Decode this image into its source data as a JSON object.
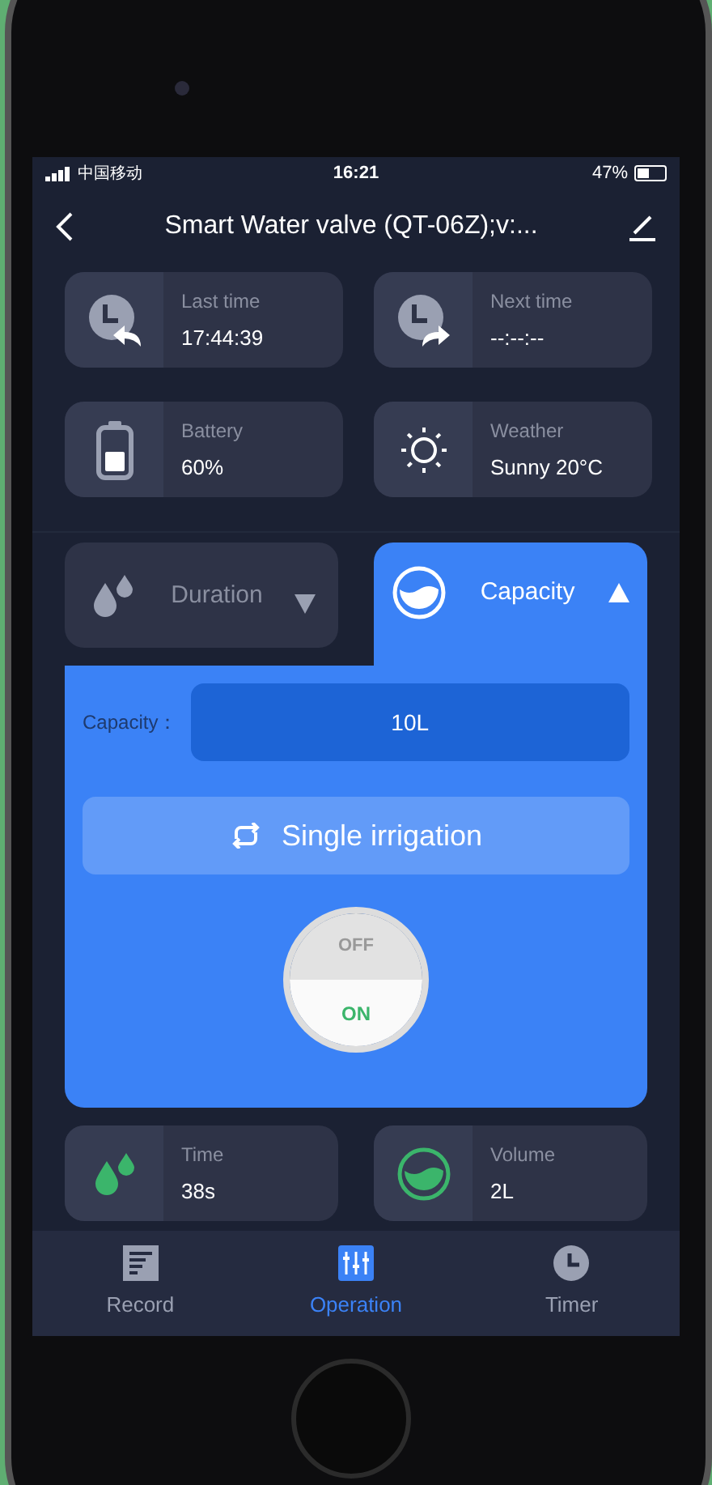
{
  "status_bar": {
    "carrier": "中国移动",
    "time": "16:21",
    "battery": "47%"
  },
  "header": {
    "title": "Smart Water valve (QT-06Z);v:..."
  },
  "info_cards": [
    {
      "kind": "last",
      "label": "Last time",
      "value": "17:44:39"
    },
    {
      "kind": "next",
      "label": "Next time",
      "value": "--:--:--"
    },
    {
      "kind": "battery",
      "label": "Battery",
      "value": "60%"
    },
    {
      "kind": "weather",
      "label": "Weather",
      "value": "Sunny 20°C"
    }
  ],
  "mode_tabs": [
    {
      "kind": "drops",
      "label": "Duration",
      "selected": false
    },
    {
      "kind": "water",
      "label": "Capacity",
      "selected": true
    }
  ],
  "capacity_field": {
    "label": "Capacity：",
    "value": "10L"
  },
  "mode_button": {
    "label": "Single irrigation"
  },
  "power_switch": {
    "off_label": "OFF",
    "on_label": "ON",
    "on": true
  },
  "stats": [
    {
      "kind": "drops",
      "label": "Time",
      "value": "38s"
    },
    {
      "kind": "water",
      "label": "Volume",
      "value": "2L"
    }
  ],
  "nav": [
    {
      "kind": "record",
      "label": "Record",
      "selected": false
    },
    {
      "kind": "operation",
      "label": "Operation",
      "selected": true
    },
    {
      "kind": "timer",
      "label": "Timer",
      "selected": false
    }
  ]
}
